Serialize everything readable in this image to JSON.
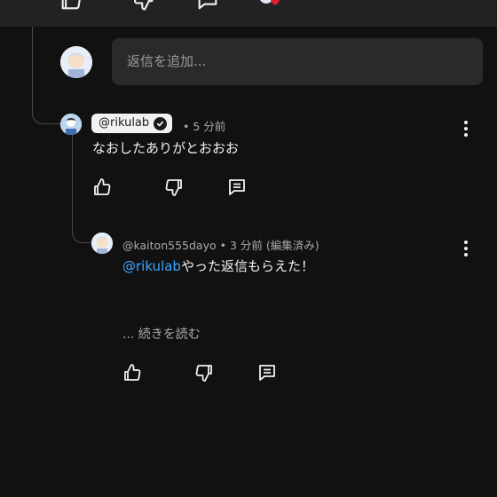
{
  "reply_box": {
    "placeholder": "返信を追加..."
  },
  "comment": {
    "author": "@rikulab",
    "time": "• 5 分前",
    "text": "なおしたありがとおおお"
  },
  "reply": {
    "author": "@kaiton555dayo",
    "time": "• 3 分前 (編集済み)",
    "mention": "@rikulab",
    "text": "やった返信もらえた！",
    "read_more": "... 続きを読む"
  },
  "icons": {
    "like": "thumbs-up-icon",
    "dislike": "thumbs-down-icon",
    "reply": "reply-comment-icon",
    "more": "more-vertical-icon",
    "verified": "verified-check-icon"
  },
  "colors": {
    "background": "#111111",
    "mention": "#3ea6ff",
    "reaction_heart": "#e0202e"
  }
}
